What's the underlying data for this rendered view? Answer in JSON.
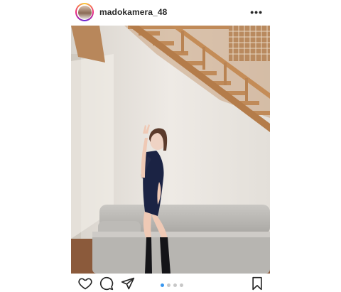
{
  "post": {
    "username": "madokamera_48",
    "more_label": "•••",
    "photo_alt": "",
    "carousel": {
      "total": 4,
      "active_index": 0
    }
  },
  "actions": {
    "like_icon": "heart-icon",
    "comment_icon": "comment-icon",
    "share_icon": "paper-plane-icon",
    "save_icon": "bookmark-icon"
  },
  "colors": {
    "accent": "#3897f0",
    "text": "#262626"
  }
}
